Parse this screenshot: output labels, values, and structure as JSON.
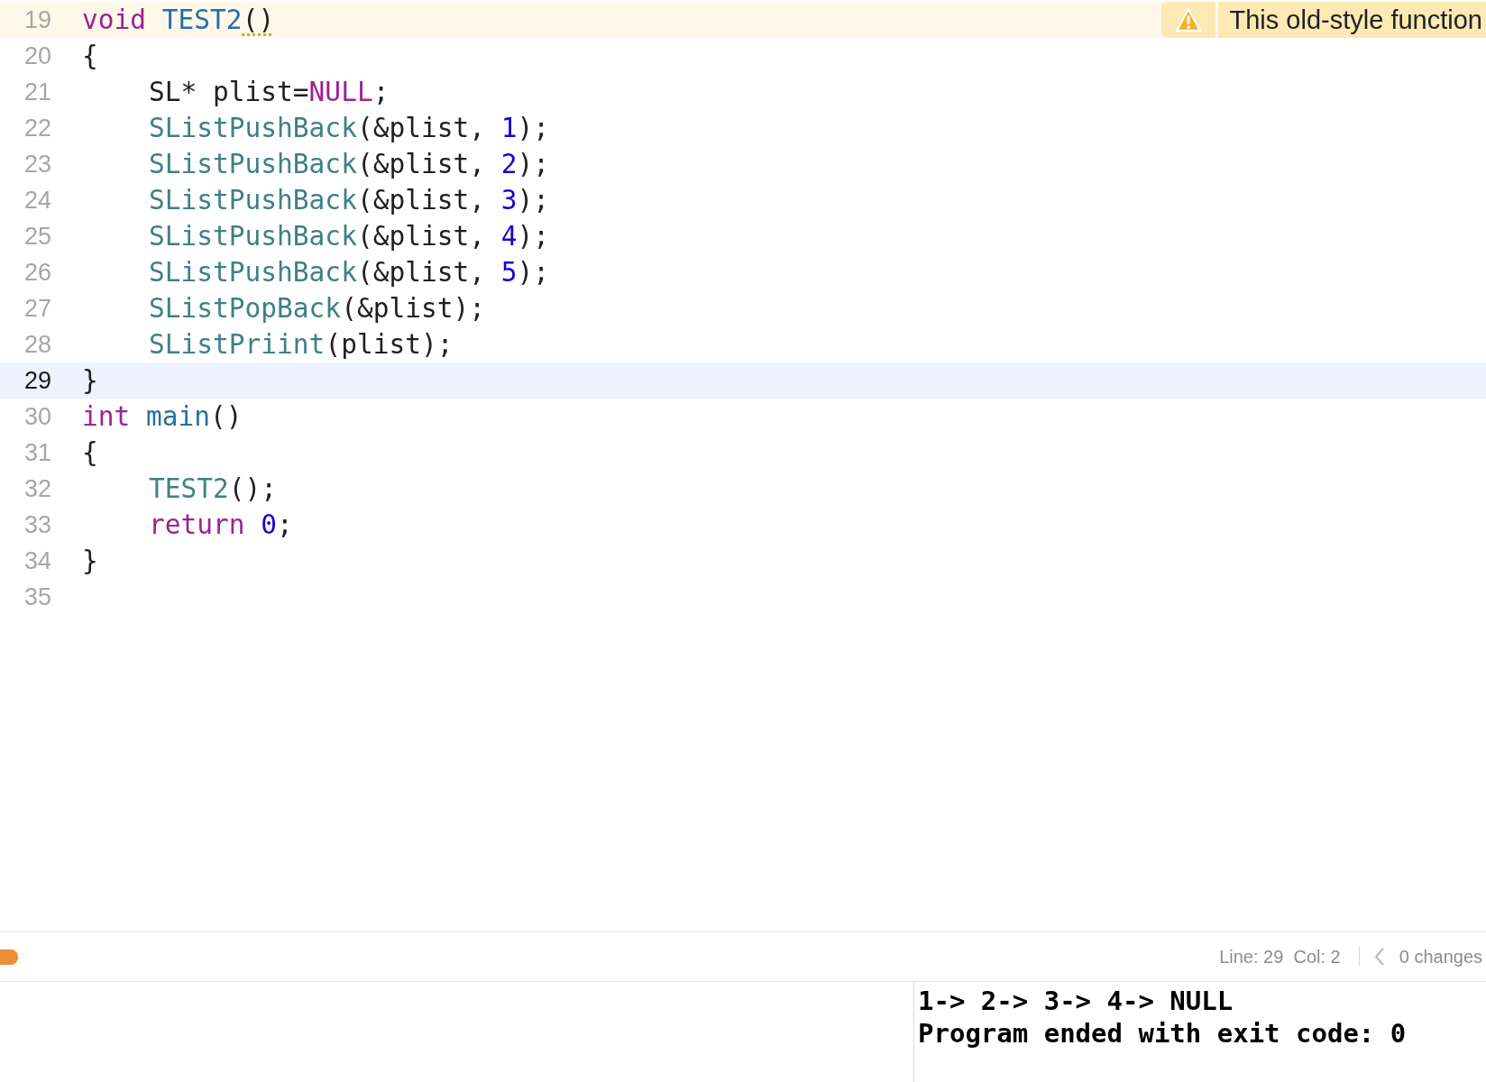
{
  "editor": {
    "lines": [
      {
        "number": "19",
        "current": false,
        "indent": false,
        "tokens": [
          {
            "kind": "keyword",
            "text": "void "
          },
          {
            "kind": "decl",
            "text": "TEST2"
          },
          {
            "kind": "flagged",
            "text": "()"
          }
        ],
        "issue": {
          "kind": "warning",
          "message": "This old-style function"
        }
      },
      {
        "number": "20",
        "current": false,
        "indent": false,
        "tokens": [
          {
            "kind": "plain",
            "text": "{"
          }
        ]
      },
      {
        "number": "21",
        "current": false,
        "indent": true,
        "tokens": [
          {
            "kind": "plain",
            "text": "SL* plist="
          },
          {
            "kind": "keyword",
            "text": "NULL"
          },
          {
            "kind": "plain",
            "text": ";"
          }
        ]
      },
      {
        "number": "22",
        "current": false,
        "indent": true,
        "tokens": [
          {
            "kind": "func",
            "text": "SListPushBack"
          },
          {
            "kind": "plain",
            "text": "(&plist, "
          },
          {
            "kind": "number",
            "text": "1"
          },
          {
            "kind": "plain",
            "text": ");"
          }
        ]
      },
      {
        "number": "23",
        "current": false,
        "indent": true,
        "tokens": [
          {
            "kind": "func",
            "text": "SListPushBack"
          },
          {
            "kind": "plain",
            "text": "(&plist, "
          },
          {
            "kind": "number",
            "text": "2"
          },
          {
            "kind": "plain",
            "text": ");"
          }
        ]
      },
      {
        "number": "24",
        "current": false,
        "indent": true,
        "tokens": [
          {
            "kind": "func",
            "text": "SListPushBack"
          },
          {
            "kind": "plain",
            "text": "(&plist, "
          },
          {
            "kind": "number",
            "text": "3"
          },
          {
            "kind": "plain",
            "text": ");"
          }
        ]
      },
      {
        "number": "25",
        "current": false,
        "indent": true,
        "tokens": [
          {
            "kind": "func",
            "text": "SListPushBack"
          },
          {
            "kind": "plain",
            "text": "(&plist, "
          },
          {
            "kind": "number",
            "text": "4"
          },
          {
            "kind": "plain",
            "text": ");"
          }
        ]
      },
      {
        "number": "26",
        "current": false,
        "indent": true,
        "tokens": [
          {
            "kind": "func",
            "text": "SListPushBack"
          },
          {
            "kind": "plain",
            "text": "(&plist, "
          },
          {
            "kind": "number",
            "text": "5"
          },
          {
            "kind": "plain",
            "text": ");"
          }
        ]
      },
      {
        "number": "27",
        "current": false,
        "indent": true,
        "tokens": [
          {
            "kind": "func",
            "text": "SListPopBack"
          },
          {
            "kind": "plain",
            "text": "(&plist);"
          }
        ]
      },
      {
        "number": "28",
        "current": false,
        "indent": true,
        "tokens": [
          {
            "kind": "func",
            "text": "SListPriint"
          },
          {
            "kind": "plain",
            "text": "(plist);"
          }
        ]
      },
      {
        "number": "29",
        "current": true,
        "indent": false,
        "tokens": [
          {
            "kind": "plain",
            "text": "}"
          }
        ]
      },
      {
        "number": "30",
        "current": false,
        "indent": false,
        "tokens": [
          {
            "kind": "keyword",
            "text": "int "
          },
          {
            "kind": "decl",
            "text": "main"
          },
          {
            "kind": "plain",
            "text": "()"
          }
        ]
      },
      {
        "number": "31",
        "current": false,
        "indent": false,
        "tokens": [
          {
            "kind": "plain",
            "text": "{"
          }
        ]
      },
      {
        "number": "32",
        "current": false,
        "indent": true,
        "tokens": [
          {
            "kind": "func",
            "text": "TEST2"
          },
          {
            "kind": "plain",
            "text": "();"
          }
        ]
      },
      {
        "number": "33",
        "current": false,
        "indent": true,
        "tokens": [
          {
            "kind": "keyword",
            "text": "return "
          },
          {
            "kind": "number",
            "text": "0"
          },
          {
            "kind": "plain",
            "text": ";"
          }
        ]
      },
      {
        "number": "34",
        "current": false,
        "indent": false,
        "tokens": [
          {
            "kind": "plain",
            "text": "}"
          }
        ]
      },
      {
        "number": "35",
        "current": false
      }
    ]
  },
  "status_bar": {
    "position": "Line: 29  Col: 2",
    "changes": "0 changes"
  },
  "console": {
    "lines": [
      "1-> 2-> 3-> 4-> NULL",
      "Program ended with exit code: 0"
    ]
  }
}
